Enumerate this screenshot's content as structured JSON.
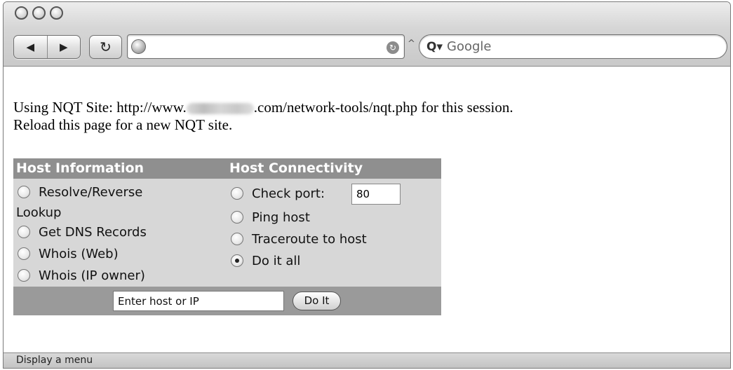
{
  "browser": {
    "search_placeholder": "Google",
    "url_value": ""
  },
  "content": {
    "site_line_prefix": "Using NQT Site: http://www.",
    "site_line_suffix": ".com/network-tools/nqt.php for this session.",
    "reload_line": "Reload this page for a new NQT site."
  },
  "tool": {
    "host_info_header": "Host Information",
    "host_conn_header": "Host Connectivity",
    "host_info_options": [
      "Resolve/Reverse",
      "Lookup",
      "Get DNS Records",
      "Whois (Web)",
      "Whois (IP owner)"
    ],
    "conn_options": [
      "Check port:",
      "Ping host",
      "Traceroute to host",
      "Do it all"
    ],
    "port_value": "80",
    "host_input_value": "Enter host or IP",
    "submit_label": "Do It",
    "selected_option": "Do it all"
  },
  "status": {
    "text": "Display a menu"
  }
}
